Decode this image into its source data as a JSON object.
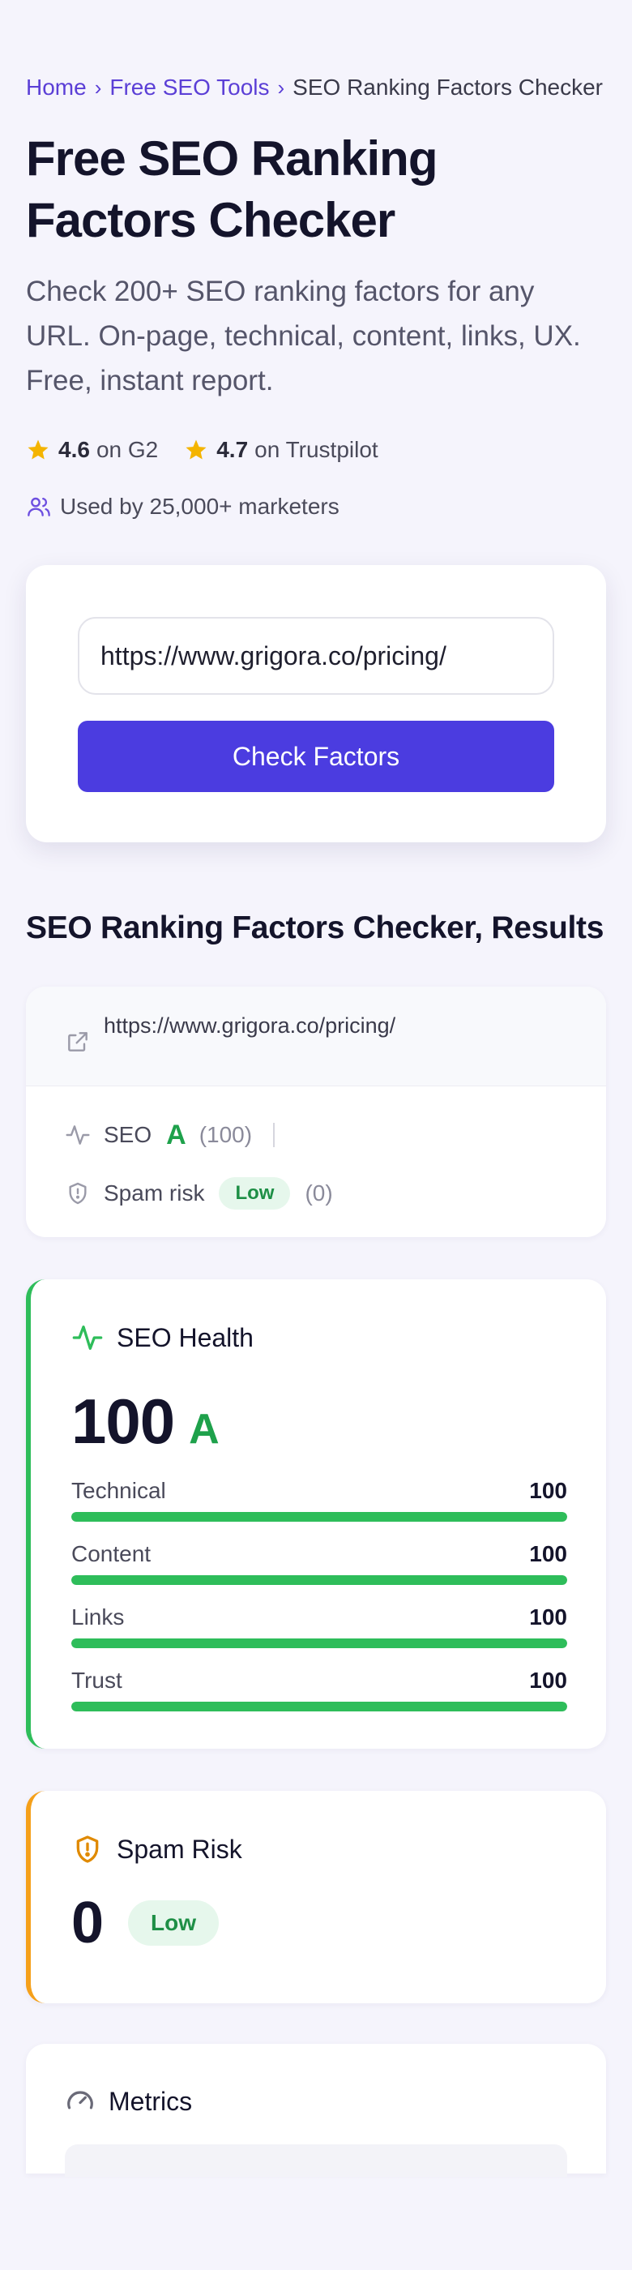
{
  "breadcrumb": {
    "home": "Home",
    "tools": "Free SEO Tools",
    "current": "SEO Ranking Factors Checker",
    "separator": "›"
  },
  "hero": {
    "title": "Free SEO Ranking Factors Checker",
    "subtitle": "Check 200+ SEO ranking factors for any URL. On-page, technical, content, links, UX. Free, instant report.",
    "ratings": [
      {
        "score": "4.6",
        "source": "on G2"
      },
      {
        "score": "4.7",
        "source": "on Trustpilot"
      }
    ],
    "users_text": "Used by 25,000+ marketers"
  },
  "form": {
    "url_value": "https://www.grigora.co/pricing/",
    "button_label": "Check Factors"
  },
  "results": {
    "heading": "SEO Ranking Factors Checker, Results",
    "summary": {
      "url": "https://www.grigora.co/pricing/",
      "seo_label": "SEO",
      "seo_grade": "A",
      "seo_score": "(100)",
      "spam_label": "Spam risk",
      "spam_level": "Low",
      "spam_score": "(0)"
    },
    "health": {
      "title": "SEO Health",
      "score": "100",
      "grade": "A",
      "metrics": [
        {
          "label": "Technical",
          "value": "100",
          "fraction": 1.0
        },
        {
          "label": "Content",
          "value": "100",
          "fraction": 1.0
        },
        {
          "label": "Links",
          "value": "100",
          "fraction": 1.0
        },
        {
          "label": "Trust",
          "value": "100",
          "fraction": 1.0
        }
      ]
    },
    "spam": {
      "title": "Spam Risk",
      "score": "0",
      "level": "Low"
    },
    "metrics_card": {
      "title": "Metrics"
    }
  },
  "colors": {
    "accent": "#4b3ce0",
    "link": "#5b3fd6",
    "good": "#2ebd5a",
    "warning": "#f5a01a",
    "star": "#f4b400"
  },
  "icons": {
    "rating": "star-icon",
    "users": "users-icon",
    "external": "external-link-icon",
    "seo": "activity-icon",
    "spam": "shield-icon",
    "health": "activity-icon",
    "spam_card": "shield-alert-icon",
    "metrics": "gauge-icon"
  }
}
